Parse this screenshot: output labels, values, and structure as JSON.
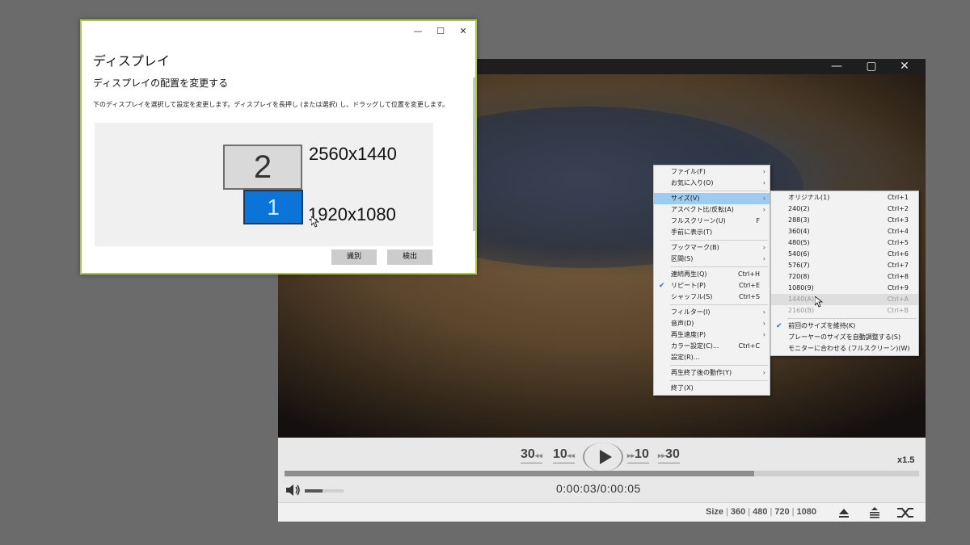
{
  "player": {
    "titlebar": {
      "minimize": "—",
      "maximize": "▢",
      "close": "✕"
    },
    "controls": {
      "skip_back_30": "30",
      "skip_back_10": "10",
      "skip_fwd_10": "10",
      "skip_fwd_30": "30",
      "speed": "x1.5",
      "time": "0:00:03/0:00:05",
      "seek_progress": 0.74,
      "volume_level": 0.45
    },
    "bottom_bar": {
      "size_label": "Size",
      "sizes": [
        "360",
        "480",
        "720",
        "1080"
      ]
    }
  },
  "context_menu": {
    "items": [
      {
        "label": "ファイル(F)",
        "submenu": true
      },
      {
        "label": "お気に入り(O)",
        "submenu": true
      },
      {
        "label": "サイズ(V)",
        "submenu": true,
        "selected": true
      },
      {
        "label": "アスペクト比/反転(A)",
        "submenu": true
      },
      {
        "label": "フルスクリーン(U)",
        "shortcut": "F"
      },
      {
        "label": "手前に表示(T)"
      },
      {
        "label": "ブックマーク(B)",
        "submenu": true
      },
      {
        "label": "区間(S)",
        "submenu": true
      },
      {
        "label": "連続再生(Q)",
        "shortcut": "Ctrl+H"
      },
      {
        "label": "リピート(P)",
        "shortcut": "Ctrl+E",
        "checked": true
      },
      {
        "label": "シャッフル(S)",
        "shortcut": "Ctrl+S"
      },
      {
        "label": "フィルター(I)",
        "submenu": true
      },
      {
        "label": "音声(D)",
        "submenu": true
      },
      {
        "label": "再生速度(P)",
        "submenu": true
      },
      {
        "label": "カラー設定(C)...",
        "shortcut": "Ctrl+C"
      },
      {
        "label": "設定(R)..."
      },
      {
        "label": "再生終了後の動作(Y)",
        "submenu": true
      },
      {
        "label": "終了(X)"
      }
    ]
  },
  "size_submenu": {
    "items": [
      {
        "label": "オリジナル(1)",
        "shortcut": "Ctrl+1"
      },
      {
        "label": "240(2)",
        "shortcut": "Ctrl+2"
      },
      {
        "label": "288(3)",
        "shortcut": "Ctrl+3"
      },
      {
        "label": "360(4)",
        "shortcut": "Ctrl+4"
      },
      {
        "label": "480(5)",
        "shortcut": "Ctrl+5"
      },
      {
        "label": "540(6)",
        "shortcut": "Ctrl+6"
      },
      {
        "label": "576(7)",
        "shortcut": "Ctrl+7"
      },
      {
        "label": "720(8)",
        "shortcut": "Ctrl+8"
      },
      {
        "label": "1080(9)",
        "shortcut": "Ctrl+9"
      },
      {
        "label": "1440(A)",
        "shortcut": "Ctrl+A",
        "disabled": true
      },
      {
        "label": "2160(B)",
        "shortcut": "Ctrl+B",
        "disabled": true
      },
      {
        "label": "前回のサイズを維持(K)",
        "checked": true
      },
      {
        "label": "プレーヤーのサイズを自動調整する(S)"
      },
      {
        "label": "モニターに合わせる (フルスクリーン)(W)"
      }
    ]
  },
  "display_dialog": {
    "title": "ディスプレイ",
    "heading": "ディスプレイの配置を変更する",
    "description": "下のディスプレイを選択して設定を変更します。ディスプレイを長押し (または選択) し、ドラッグして位置を変更します。",
    "monitor_2": {
      "number": "2",
      "resolution": "2560x1440"
    },
    "monitor_1": {
      "number": "1",
      "resolution": "1920x1080"
    },
    "identify_button": "識別",
    "detect_button": "検出",
    "window_controls": {
      "minimize": "—",
      "maximize": "☐",
      "close": "✕"
    },
    "colors": {
      "selected_monitor": "#0a74d8",
      "border": "#a8c94b"
    }
  }
}
